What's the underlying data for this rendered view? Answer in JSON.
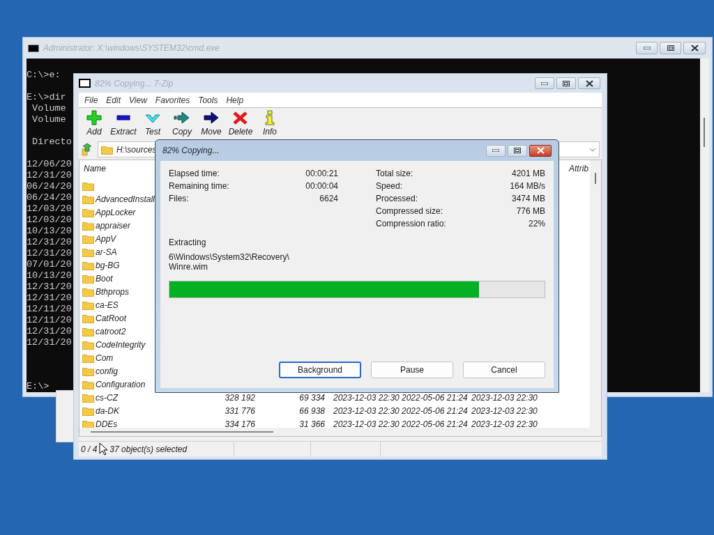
{
  "cmd_window": {
    "title": "Administrator: X:\\windows\\SYSTEM32\\cmd.exe",
    "active": false,
    "console_blocks": [
      [
        "C:\\>e:"
      ],
      [
        "E:\\>dir",
        " Volume",
        " Volume"
      ],
      [
        " Directo"
      ],
      [
        "12/06/20",
        "12/31/20",
        "06/24/20",
        "06/24/20",
        "12/03/20",
        "12/03/20",
        "10/13/20",
        "12/31/20",
        "12/31/20",
        "07/01/20",
        "10/13/20",
        "12/31/20",
        "12/31/20",
        "12/11/20",
        "12/11/20",
        "12/31/20",
        "12/31/20"
      ]
    ],
    "prompt": "E:\\>"
  },
  "zip_window": {
    "title": "82% Copying... 7-Zip",
    "active": false,
    "menu": [
      "File",
      "Edit",
      "View",
      "Favorites",
      "Tools",
      "Help"
    ],
    "toolbar": [
      {
        "label": "Add",
        "kind": "add"
      },
      {
        "label": "Extract",
        "kind": "extract"
      },
      {
        "label": "Test",
        "kind": "test"
      },
      {
        "label": "Copy",
        "kind": "copy"
      },
      {
        "label": "Move",
        "kind": "move"
      },
      {
        "label": "Delete",
        "kind": "delete"
      },
      {
        "label": "Info",
        "kind": "info"
      }
    ],
    "address": "H:\\sources",
    "columns": {
      "name": "Name",
      "attrib": "Attrib"
    },
    "rows": [
      {},
      {
        "name": "AdvancedInstall"
      },
      {
        "name": "AppLocker"
      },
      {
        "name": "appraiser"
      },
      {
        "name": "AppV"
      },
      {
        "name": "ar-SA"
      },
      {
        "name": "bg-BG"
      },
      {
        "name": "Boot"
      },
      {
        "name": "Bthprops"
      },
      {
        "name": "ca-ES"
      },
      {
        "name": "CatRoot"
      },
      {
        "name": "catroot2"
      },
      {
        "name": "CodeIntegrity"
      },
      {
        "name": "Com"
      },
      {
        "name": "config"
      },
      {
        "name": "Configuration"
      },
      {
        "name": "cs-CZ",
        "size": "328 192",
        "packed": "69 334",
        "modified": "2023-12-03 22:30",
        "created": "2022-05-06 21:24",
        "accessed": "2023-12-03 22:30"
      },
      {
        "name": "da-DK",
        "size": "331 776",
        "packed": "66 938",
        "modified": "2023-12-03 22:30",
        "created": "2022-05-06 21:24",
        "accessed": "2023-12-03 22:30"
      },
      {
        "name": "DDEs",
        "size": "334 176",
        "packed": "31 366",
        "modified": "2023-12-03 22:30",
        "created": "2022-05-06 21:24",
        "accessed": "2023-12-03 22:30"
      }
    ],
    "status_parts": [
      "0 / 4",
      "37 object(s) selected"
    ]
  },
  "dialog": {
    "title": "82% Copying...",
    "active": true,
    "left_stats": [
      {
        "label": "Elapsed time:",
        "value": "00:00:21"
      },
      {
        "label": "Remaining time:",
        "value": "00:00:04"
      },
      {
        "label": "Files:",
        "value": "6624"
      }
    ],
    "right_stats": [
      {
        "label": "Total size:",
        "value": "4201 MB"
      },
      {
        "label": "Speed:",
        "value": "164 MB/s"
      },
      {
        "label": "Processed:",
        "value": "3474 MB"
      },
      {
        "label": "Compressed size:",
        "value": "776 MB"
      },
      {
        "label": "Compression ratio:",
        "value": "22%"
      }
    ],
    "operation": "Extracting",
    "path_lines": [
      "6\\Windows\\System32\\Recovery\\",
      "Winre.wim"
    ],
    "progress": {
      "level": 0.826
    },
    "buttons": [
      {
        "label": "Background",
        "focused": true
      },
      {
        "label": "Pause",
        "focused": false
      },
      {
        "label": "Cancel",
        "focused": false
      }
    ]
  }
}
